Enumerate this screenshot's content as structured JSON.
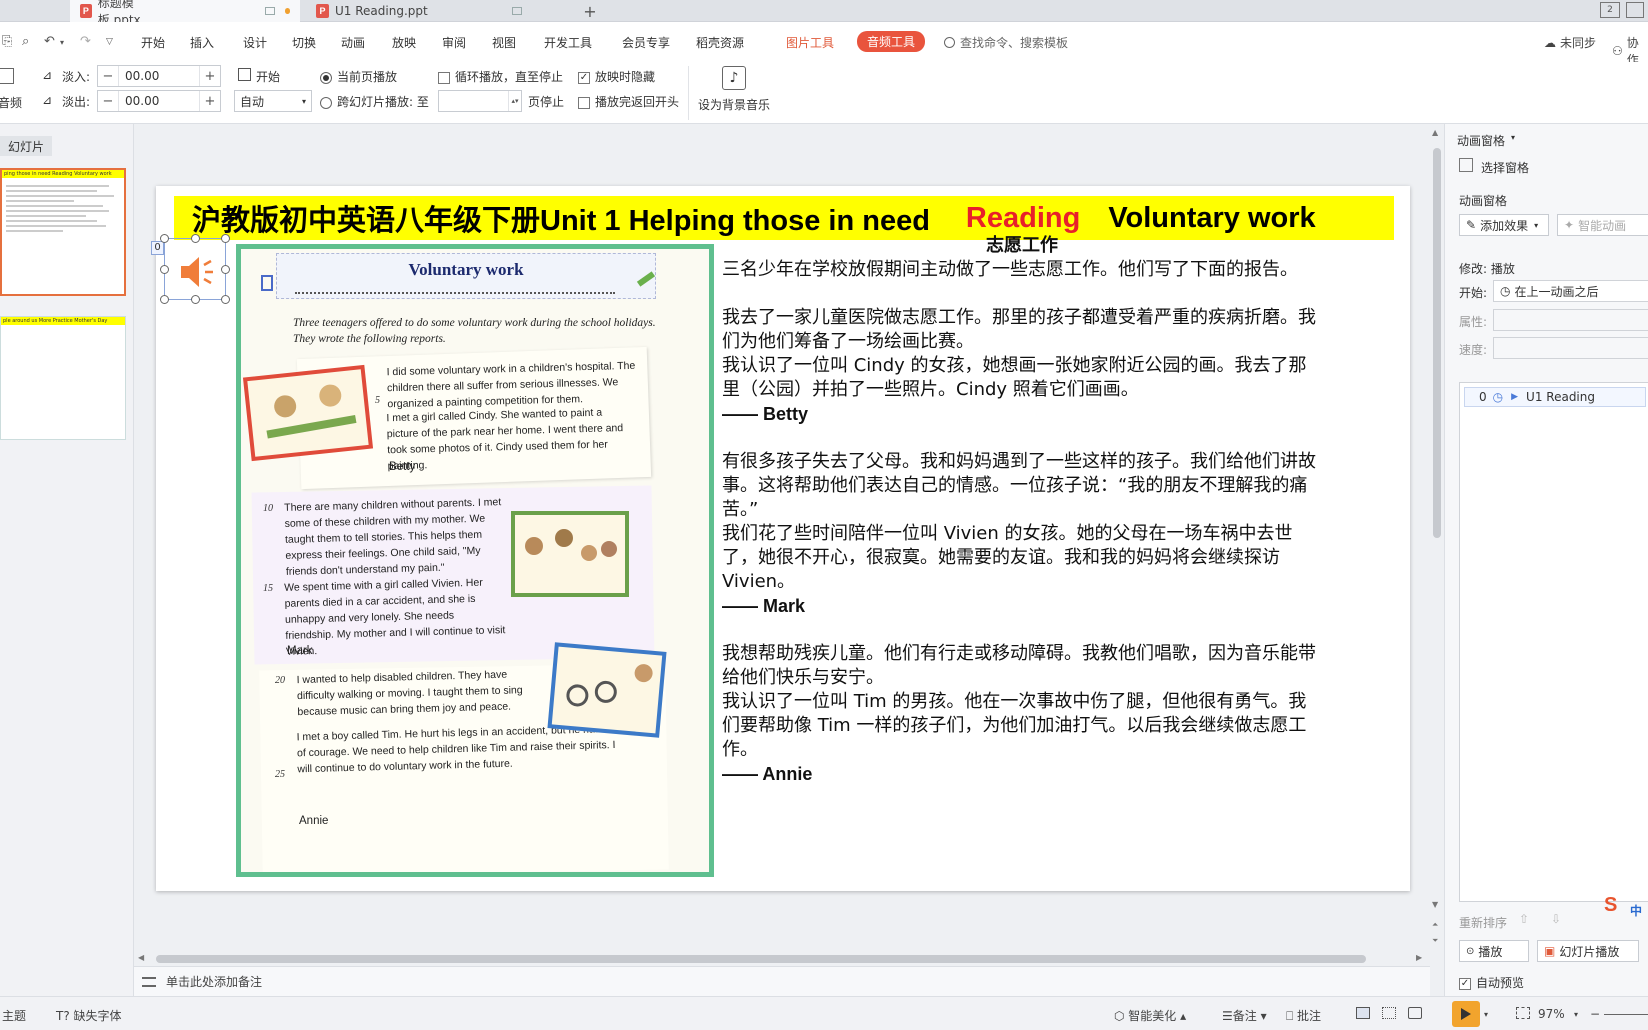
{
  "tabs": [
    {
      "label": "标题模板.pptx",
      "active": true
    },
    {
      "label": "U1 Reading.ppt",
      "active": false
    }
  ],
  "window_buttons": [
    "2"
  ],
  "menu": {
    "items": [
      "开始",
      "插入",
      "设计",
      "切换",
      "动画",
      "放映",
      "审阅",
      "视图",
      "开发工具",
      "会员专享",
      "稻壳资源"
    ],
    "picture_tools": "图片工具",
    "audio_tools": "音频工具",
    "search_placeholder": "查找命令、搜索模板",
    "sync": "未同步",
    "collab": "协作"
  },
  "ribbon": {
    "left_label": "音频",
    "fade_in_label": "淡入:",
    "fade_in_value": "00.00",
    "fade_out_label": "淡出:",
    "fade_out_value": "00.00",
    "start_label": "开始",
    "start_value": "自动",
    "current_page_play": "当前页播放",
    "cross_slide_play": "跨幻灯片播放: 至",
    "page_stop": "页停止",
    "loop_play": "循环播放，直至停止",
    "hide_when_playing": "放映时隐藏",
    "rewind_after_play": "播放完返回开头",
    "set_bg_music": "设为背景音乐"
  },
  "left_panel": {
    "tab": "幻灯片",
    "thumb1_title": "ping those in need   Reading   Voluntary work",
    "thumb2_title": "ple around us  More Practice  Mother's Day"
  },
  "slide": {
    "title_main": "沪教版初中英语八年级下册Unit 1 Helping those in need",
    "title_reading": "Reading",
    "title_voluntary": "Voluntary work",
    "anim_index": "0",
    "book": {
      "head": "Voluntary work",
      "intro": "Three teenagers offered to do some voluntary work during the school holidays. They wrote the following reports.",
      "betty_text": "I did some voluntary work in a children's hospital. The children there all suffer from serious illnesses. We organized a painting competition for them.",
      "betty_text2": "I met a girl called Cindy. She wanted to paint a picture of the park near her home. I went there and took some photos of it. Cindy used them for her painting.",
      "betty": "Betty",
      "mark_text": "There are many children without parents. I met some of these children with my mother. We taught them to tell stories. This helps them express their feelings. One child said, \"My friends don't understand my pain.\"",
      "mark_text2": "We spent time with a girl called Vivien. Her parents died in a car accident, and she is unhappy and very lonely. She needs friendship. My mother and I will continue to visit Vivien.",
      "mark": "Mark",
      "annie_text": "I wanted to help disabled children. They have difficulty walking or moving. I taught them to sing because music can bring them joy and peace.",
      "annie_text2": "I met a boy called Tim. He hurt his legs in an accident, but he has lots of courage. We need to help children like Tim and raise their spirits. I will continue to do voluntary work in the future.",
      "annie": "Annie",
      "line_nums": [
        "5",
        "10",
        "15",
        "20",
        "25"
      ]
    },
    "cn_title": "志愿工作",
    "cn_p1": "三名少年在学校放假期间主动做了一些志愿工作。他们写了下面的报告。",
    "cn_p2": "我去了一家儿童医院做志愿工作。那里的孩子都遭受着严重的疾病折磨。我们为他们筹备了一场绘画比赛。",
    "cn_p3": "我认识了一位叫 Cindy 的女孩，她想画一张她家附近公园的画。我去了那里（公园）并拍了一些照片。Cindy 照着它们画画。",
    "sign_betty": "—— Betty",
    "cn_p4": "有很多孩子失去了父母。我和妈妈遇到了一些这样的孩子。我们给他们讲故事。这将帮助他们表达自己的情感。一位孩子说：“我的朋友不理解我的痛苦。”",
    "cn_p5": "我们花了些时间陪伴一位叫 Vivien 的女孩。她的父母在一场车祸中去世了，她很不开心，很寂寞。她需要的友谊。我和我的妈妈将会继续探访 Vivien。",
    "sign_mark": "—— Mark",
    "cn_p6": "我想帮助残疾儿童。他们有行走或移动障碍。我教他们唱歌，因为音乐能带给他们快乐与安宁。",
    "cn_p7": "我认识了一位叫 Tim 的男孩。他在一次事故中伤了腿，但他很有勇气。我们要帮助像 Tim 一样的孩子们，为他们加油打气。以后我会继续做志愿工作。",
    "sign_annie": "—— Annie"
  },
  "notes_placeholder": "单击此处添加备注",
  "right_panel": {
    "header": "动画窗格",
    "select_pane": "选择窗格",
    "anim_pane": "动画窗格",
    "add_effect": "添加效果",
    "smart_anim": "智能动画",
    "modify": "修改: 播放",
    "start_label": "开始:",
    "start_value": "在上一动画之后",
    "property_label": "属性:",
    "speed_label": "速度:",
    "list_item_index": "0",
    "list_item_name": "U1 Reading",
    "reorder": "重新排序",
    "play": "播放",
    "slideshow": "幻灯片播放",
    "auto_preview": "自动预览",
    "ime_label": "中"
  },
  "status": {
    "theme": "主题",
    "missing_fonts": "缺失字体",
    "smart_beautify": "智能美化",
    "notes": "备注",
    "comments": "批注",
    "zoom": "97%"
  },
  "colors": {
    "accent": "#e9543d",
    "title_band": "#ffff00",
    "reading_red": "#e8202a",
    "book_border": "#5fbf8f",
    "play_orange": "#f2a42d"
  }
}
